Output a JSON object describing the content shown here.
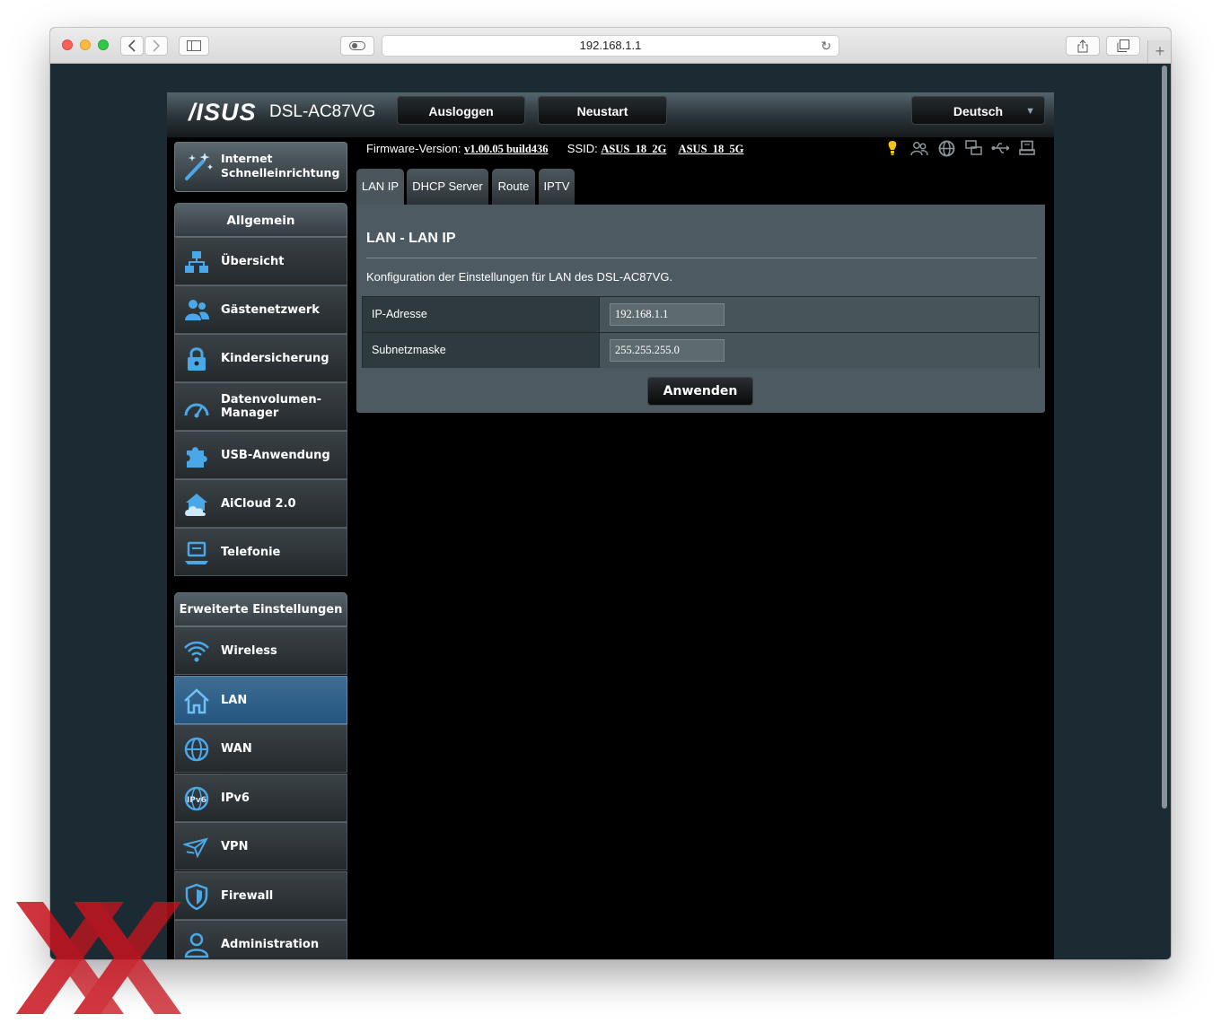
{
  "browser": {
    "url": "192.168.1.1"
  },
  "header": {
    "logo": "/ISUS",
    "model": "DSL-AC87VG",
    "logout_label": "Ausloggen",
    "reboot_label": "Neustart",
    "language": "Deutsch"
  },
  "info_bar": {
    "firmware_label": "Firmware-Version:",
    "firmware_value": "v1.00.05 build436",
    "ssid_label": "SSID:",
    "ssid_2g": "ASUS_18_2G",
    "ssid_5g": "ASUS_18_5G",
    "status_icons": [
      "lamp-icon",
      "clients-icon",
      "internet-globe-icon",
      "network-map-icon",
      "usb-icon",
      "printer-icon"
    ]
  },
  "sidebar": {
    "quick_setup_label_1": "Internet",
    "quick_setup_label_2": "Schnelleinrichtung",
    "general_header": "Allgemein",
    "general_items": [
      {
        "label": "Übersicht",
        "icon": "network-map-icon"
      },
      {
        "label": "Gästenetzwerk",
        "icon": "guest-network-icon"
      },
      {
        "label": "Kindersicherung",
        "icon": "lock-icon"
      },
      {
        "label": "Datenvolumen-",
        "label2": "Manager",
        "icon": "gauge-icon"
      },
      {
        "label": "USB-Anwendung",
        "icon": "puzzle-icon"
      },
      {
        "label": "AiCloud 2.0",
        "icon": "cloud-icon"
      },
      {
        "label": "Telefonie",
        "icon": "telephony-icon"
      }
    ],
    "advanced_header": "Erweiterte Einstellungen",
    "advanced_items": [
      {
        "label": "Wireless",
        "icon": "wifi-icon"
      },
      {
        "label": "LAN",
        "icon": "home-icon",
        "active": true
      },
      {
        "label": "WAN",
        "icon": "globe-icon"
      },
      {
        "label": "IPv6",
        "icon": "ipv6-icon"
      },
      {
        "label": "VPN",
        "icon": "vpn-icon"
      },
      {
        "label": "Firewall",
        "icon": "shield-icon"
      },
      {
        "label": "Administration",
        "icon": "user-icon"
      }
    ]
  },
  "tabs": [
    {
      "label": "LAN IP",
      "active": true
    },
    {
      "label": "DHCP Server"
    },
    {
      "label": "Route"
    },
    {
      "label": "IPTV"
    }
  ],
  "content": {
    "title": "LAN - LAN IP",
    "description": "Konfiguration der Einstellungen für LAN des DSL-AC87VG.",
    "fields": [
      {
        "label": "IP-Adresse",
        "value": "192.168.1.1"
      },
      {
        "label": "Subnetzmaske",
        "value": "255.255.255.0"
      }
    ],
    "apply_label": "Anwenden"
  },
  "colors": {
    "page_background": "#1c2a33",
    "router_background": "#000000",
    "panel_background": "#4d5a61",
    "active_menu": "#2f6590",
    "watermark": "#c8141e"
  }
}
